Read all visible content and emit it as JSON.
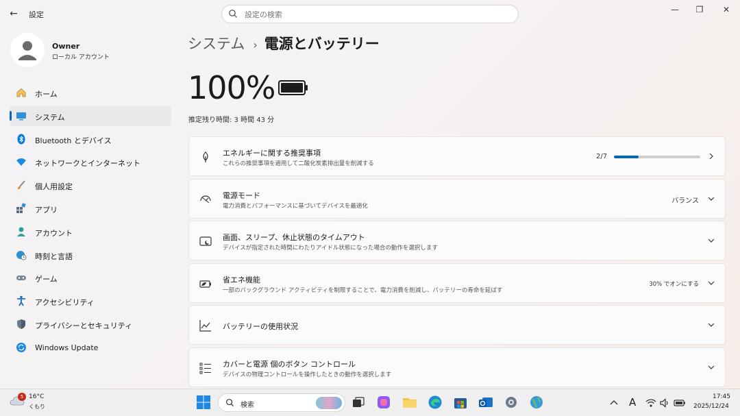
{
  "titlebar": {
    "back": "←",
    "title": "設定",
    "search_placeholder": "設定の検索",
    "minimize": "—",
    "maximize": "❐",
    "close": "✕"
  },
  "profile": {
    "name": "Owner",
    "account_type": "ローカル アカウント"
  },
  "sidebar": {
    "items": [
      {
        "label": "ホーム",
        "icon": "home-icon"
      },
      {
        "label": "システム",
        "icon": "system-icon",
        "active": true
      },
      {
        "label": "Bluetooth とデバイス",
        "icon": "bluetooth-icon"
      },
      {
        "label": "ネットワークとインターネット",
        "icon": "wifi-icon"
      },
      {
        "label": "個人用設定",
        "icon": "brush-icon"
      },
      {
        "label": "アプリ",
        "icon": "apps-icon"
      },
      {
        "label": "アカウント",
        "icon": "account-icon"
      },
      {
        "label": "時刻と言語",
        "icon": "globe-clock-icon"
      },
      {
        "label": "ゲーム",
        "icon": "gamepad-icon"
      },
      {
        "label": "アクセシビリティ",
        "icon": "accessibility-icon"
      },
      {
        "label": "プライバシーとセキュリティ",
        "icon": "shield-icon"
      },
      {
        "label": "Windows Update",
        "icon": "update-icon"
      }
    ]
  },
  "main": {
    "breadcrumb_parent": "システム",
    "breadcrumb_sep": "›",
    "breadcrumb_current": "電源とバッテリー",
    "battery_percent": "100%",
    "battery_estimate": "推定残り時間: 3 時間 43 分",
    "cards": [
      {
        "title": "エネルギーに関する推奨事項",
        "desc": "これらの推奨事項を適用して二酸化炭素排出量を削減する",
        "icon": "leaf-icon",
        "progress_label": "2/7",
        "progress": 0.2857
      },
      {
        "title": "電源モード",
        "desc": "電力消費とパフォーマンスに基づいてデバイスを最適化",
        "icon": "power-mode-icon",
        "value": "バランス"
      },
      {
        "title": "画面、スリープ、休止状態のタイムアウト",
        "desc": "デバイスが指定された時間にわたりアイドル状態になった場合の動作を選択します",
        "icon": "screen-sleep-icon"
      },
      {
        "title": "省エネ機能",
        "desc": "一部のバックグラウンド アクティビティを制限することで、電力消費を削減し、バッテリーの寿命を延ばす",
        "icon": "energy-saver-icon",
        "value": "30% でオンにする"
      },
      {
        "title": "バッテリーの使用状況",
        "icon": "usage-chart-icon"
      },
      {
        "title": "カバーと電源 個のボタン コントロール",
        "desc": "デバイスの物理コントロールを操作したときの動作を選択します",
        "icon": "buttons-list-icon"
      }
    ]
  },
  "taskbar": {
    "weather_badge": "5",
    "weather_temp": "16°C",
    "weather_condition": "くもり",
    "search_label": "検索",
    "ime": "A",
    "time": "17:45",
    "date": "2025/12/24",
    "accent": "#0067c0"
  }
}
